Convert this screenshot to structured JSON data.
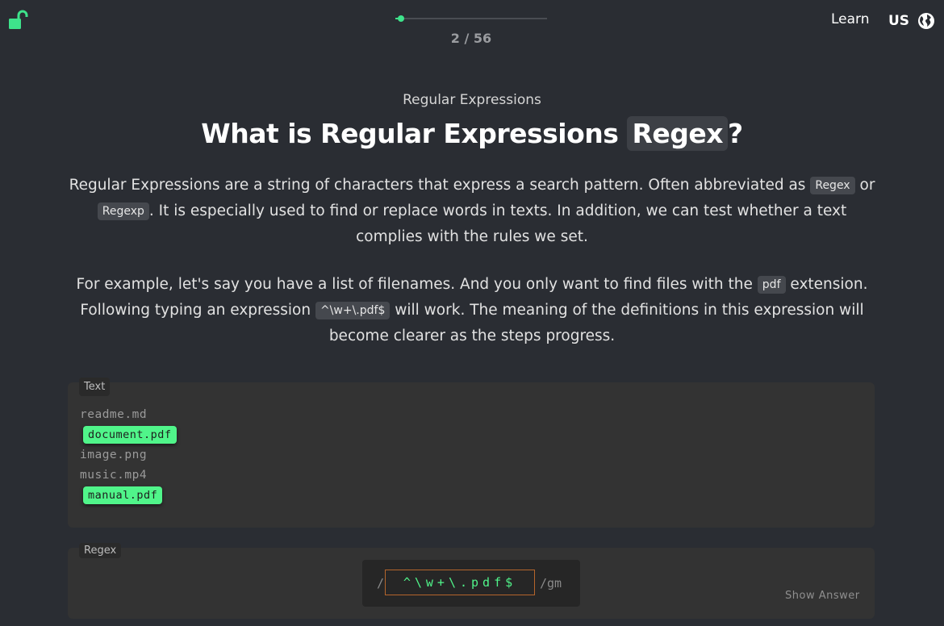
{
  "header": {
    "progress_text": "2 / 56",
    "progress_fraction": 0.0357,
    "learn_label": "Learn",
    "language_label": "US"
  },
  "lesson": {
    "category": "Regular Expressions",
    "title_prefix": "What is Regular Expressions",
    "title_pill": "Regex",
    "title_suffix": "?",
    "paragraph1": {
      "t1": "Regular Expressions are a string of characters that express a search pattern. Often abbreviated as",
      "pill1": "Regex",
      "t2": "or",
      "pill2": "Regexp",
      "t3": ". It is especially used to find or replace words in texts. In addition, we can test whether a text complies with the rules we set."
    },
    "paragraph2": {
      "t1": "For example, let's say you have a list of filenames. And you only want to find files with the",
      "pill1": "pdf",
      "t2": "extension. Following typing an expression",
      "pill2": "^\\w+\\.pdf$",
      "t3": "will work. The meaning of the definitions in this expression will become clearer as the steps progress."
    }
  },
  "text_panel": {
    "tag": "Text",
    "lines": [
      {
        "text": "readme.md",
        "match": false
      },
      {
        "text": "document.pdf",
        "match": true
      },
      {
        "text": "image.png",
        "match": false
      },
      {
        "text": "music.mp4",
        "match": false
      },
      {
        "text": "manual.pdf",
        "match": true
      }
    ]
  },
  "regex_panel": {
    "tag": "Regex",
    "open_slash": "/",
    "value": "^\\w+\\.pdf$",
    "flags": "/gm",
    "show_answer_label": "Show Answer"
  },
  "colors": {
    "accent": "#3ee38b",
    "match_highlight": "#50f58a",
    "input_border": "#b5652b",
    "background": "#2a2d33"
  },
  "icons": {
    "lock": "unlocked-padlock-icon",
    "language": "globe-icon"
  }
}
